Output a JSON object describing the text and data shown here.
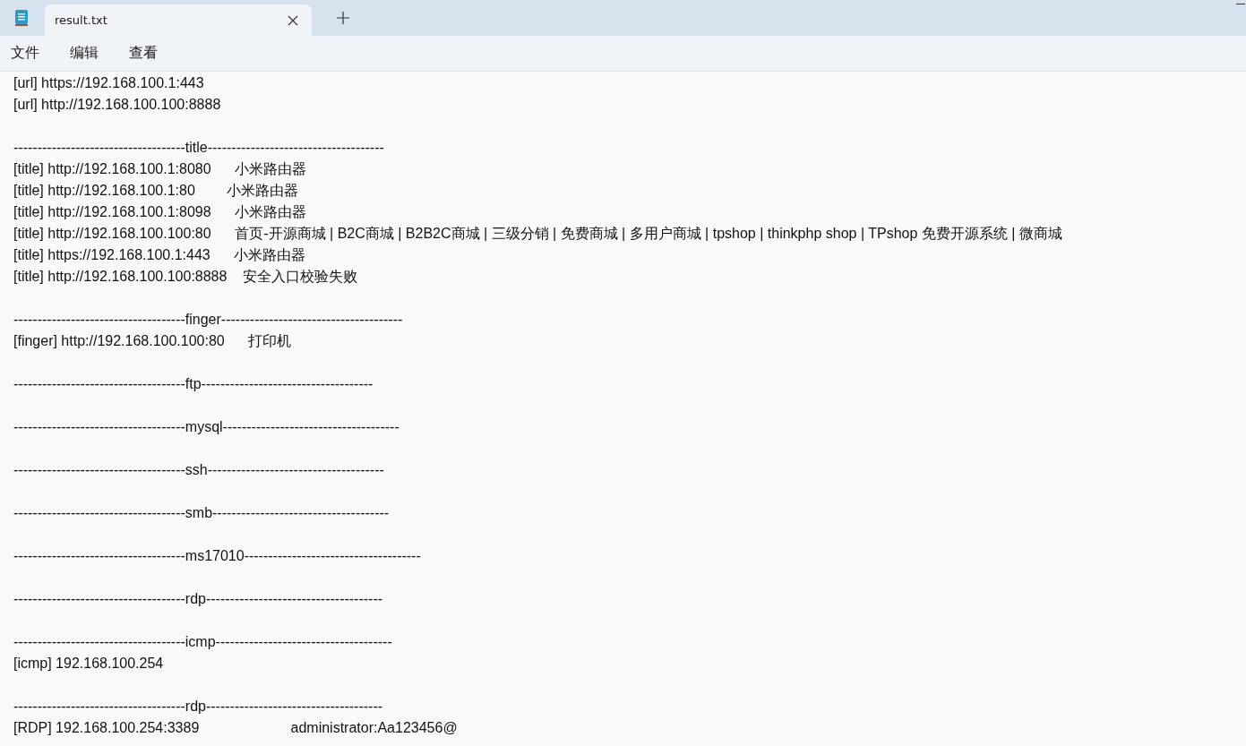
{
  "tabs": [
    {
      "label": "result.txt",
      "selected": true
    }
  ],
  "menu": [
    "文件",
    "编辑",
    "查看"
  ],
  "lines": [
    {
      "kind": "text",
      "text": "[url] https://192.168.100.1:443"
    },
    {
      "kind": "text",
      "text": "[url] http://192.168.100.100:8888"
    },
    {
      "kind": "blank"
    },
    {
      "kind": "text",
      "text": "------------------------------------title-------------------------------------"
    },
    {
      "kind": "text",
      "text": "[title] http://192.168.100.1:8080      小米路由器"
    },
    {
      "kind": "text",
      "text": "[title] http://192.168.100.1:80        小米路由器"
    },
    {
      "kind": "text",
      "text": "[title] http://192.168.100.1:8098      小米路由器"
    },
    {
      "kind": "text",
      "text": "[title] http://192.168.100.100:80      首页-开源商城 | B2C商城 | B2B2C商城 | 三级分销 | 免费商城 | 多用户商城 | tpshop | thinkphp shop | TPshop 免费开源系统 | 微商城"
    },
    {
      "kind": "text",
      "text": "[title] https://192.168.100.1:443      小米路由器"
    },
    {
      "kind": "text",
      "text": "[title] http://192.168.100.100:8888    安全入口校验失败"
    },
    {
      "kind": "blank"
    },
    {
      "kind": "text",
      "text": "------------------------------------finger--------------------------------------"
    },
    {
      "kind": "text",
      "text": "[finger] http://192.168.100.100:80      打印机"
    },
    {
      "kind": "blank"
    },
    {
      "kind": "text",
      "text": "------------------------------------ftp------------------------------------"
    },
    {
      "kind": "blank"
    },
    {
      "kind": "text",
      "text": "------------------------------------mysql-------------------------------------"
    },
    {
      "kind": "blank"
    },
    {
      "kind": "text",
      "text": "------------------------------------ssh-------------------------------------"
    },
    {
      "kind": "blank"
    },
    {
      "kind": "text",
      "text": "------------------------------------smb-------------------------------------"
    },
    {
      "kind": "blank"
    },
    {
      "kind": "text",
      "text": "------------------------------------ms17010-------------------------------------"
    },
    {
      "kind": "blank"
    },
    {
      "kind": "text",
      "text": "------------------------------------rdp-------------------------------------"
    },
    {
      "kind": "blank"
    },
    {
      "kind": "text",
      "text": "------------------------------------icmp-------------------------------------"
    },
    {
      "kind": "text",
      "text": "[icmp] 192.168.100.254"
    },
    {
      "kind": "blank"
    },
    {
      "kind": "text",
      "text": "------------------------------------rdp-------------------------------------"
    },
    {
      "kind": "text",
      "text": "[RDP] 192.168.100.254:3389                       administrator:Aa123456@"
    }
  ]
}
